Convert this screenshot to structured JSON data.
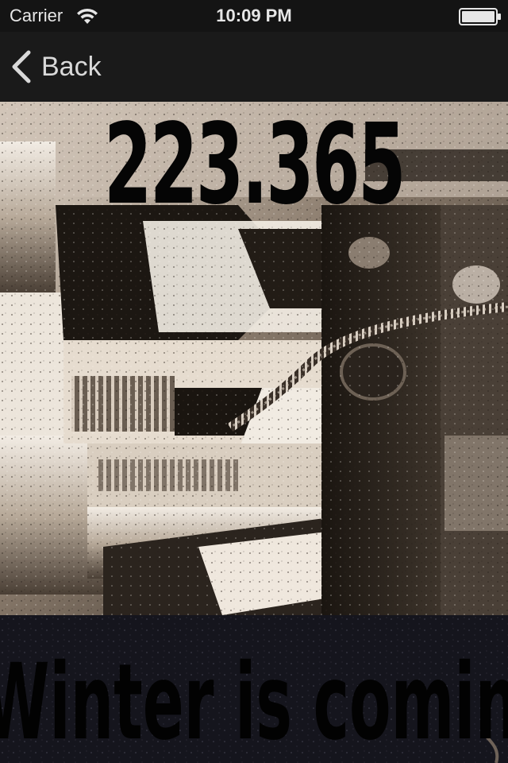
{
  "status_bar": {
    "carrier": "Carrier",
    "time": "10:09 PM",
    "wifi_icon": "wifi-icon",
    "battery_icon": "battery-icon"
  },
  "nav": {
    "back_label": "Back",
    "back_icon": "chevron-left-icon"
  },
  "hero": {
    "value": "223.365",
    "photo_description_icon": "guitar-bridge-photo",
    "favorite_icon": "star-icon"
  },
  "caption": {
    "text": "Winter is coming"
  },
  "colors": {
    "status_bar_bg": "#141414",
    "nav_bar_bg": "#1a1a1a",
    "favorite_star": "#3fc0f5",
    "caption_text": "#020202"
  }
}
